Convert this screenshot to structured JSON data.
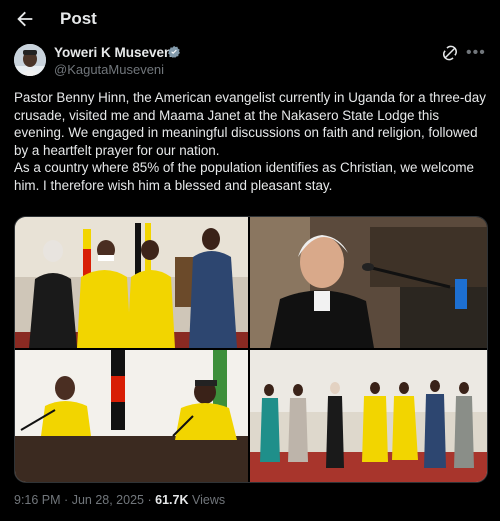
{
  "header": {
    "title": "Post",
    "back_icon": "arrow-left-icon"
  },
  "author": {
    "name": "Yoweri K Museveni",
    "handle": "@KagutaMuseveni",
    "verified": true
  },
  "post": {
    "paragraph1": "Pastor Benny Hinn, the American evangelist currently in Uganda for a three-day crusade, visited me and Maama Janet at the Nakasero State Lodge this evening. We engaged in meaningful discussions on faith and religion, followed by a heartfelt prayer for our nation.",
    "paragraph2": "As a country where 85% of the population identifies as Christian, we welcome him.  I therefore wish  him a blessed and pleasant stay."
  },
  "meta": {
    "time": "9:16 PM",
    "sep": "·",
    "date": "Jun 28, 2025",
    "sep2": "·",
    "views_count": "61.7K",
    "views_label": "Views"
  },
  "colors": {
    "accent": "#1d9bf0",
    "background": "#000000",
    "muted": "#71767b",
    "jersey_yellow": "#f2d500"
  }
}
